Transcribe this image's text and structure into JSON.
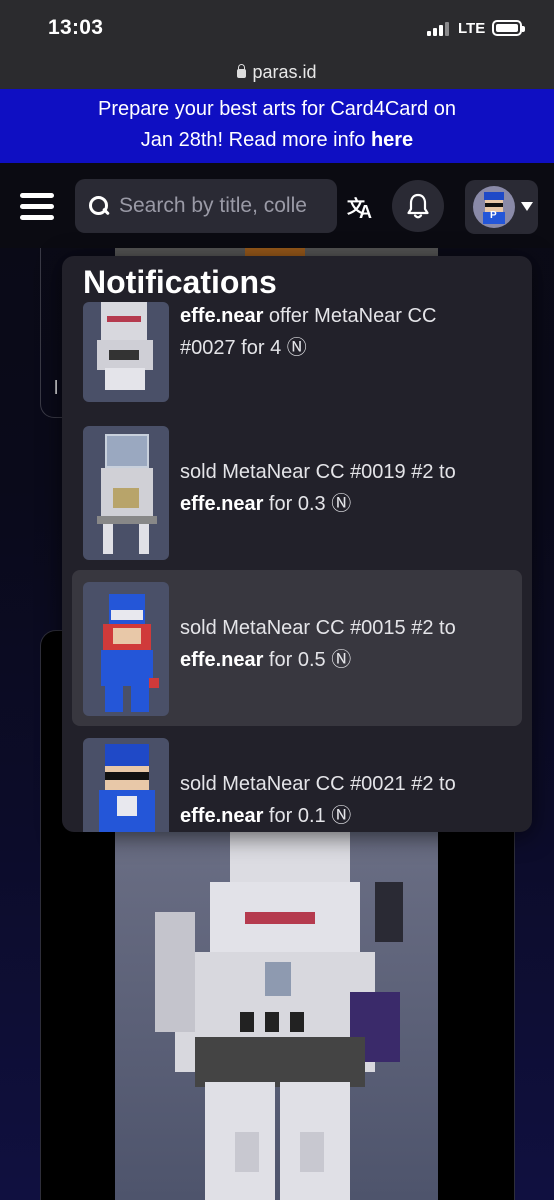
{
  "status_bar": {
    "time": "13:03",
    "network": "LTE"
  },
  "browser": {
    "url": "paras.id"
  },
  "banner": {
    "line1": "Prepare your best arts for Card4Card on",
    "line2_prefix": "Jan 28th! Read more info ",
    "line2_link": "here"
  },
  "header": {
    "search_placeholder": "Search by title, colle",
    "translate_glyph_a": "文",
    "translate_glyph_b": "A"
  },
  "background": {
    "card_label_fragment": "l"
  },
  "notifications": {
    "title": "Notifications",
    "items": [
      {
        "user": "effe.near",
        "action": " offer ",
        "item": "MetaNear CC",
        "line2": "#0027 for 4 Ⓝ"
      },
      {
        "action": "sold ",
        "item": "MetaNear CC #0019 #2",
        "mid": " to",
        "user": "effe.near",
        "tail": " for 0.3 Ⓝ"
      },
      {
        "action": "sold ",
        "item": "MetaNear CC #0015 #2",
        "mid": " to",
        "user": "effe.near",
        "tail": " for 0.5 Ⓝ"
      },
      {
        "action": "sold ",
        "item": "MetaNear CC #0021 #2",
        "mid": " to",
        "user": "effe.near",
        "tail": " for 0.1 Ⓝ"
      }
    ]
  },
  "colors": {
    "banner": "#0f0fc2",
    "panel": "#22212a",
    "active_row": "#38373f"
  }
}
